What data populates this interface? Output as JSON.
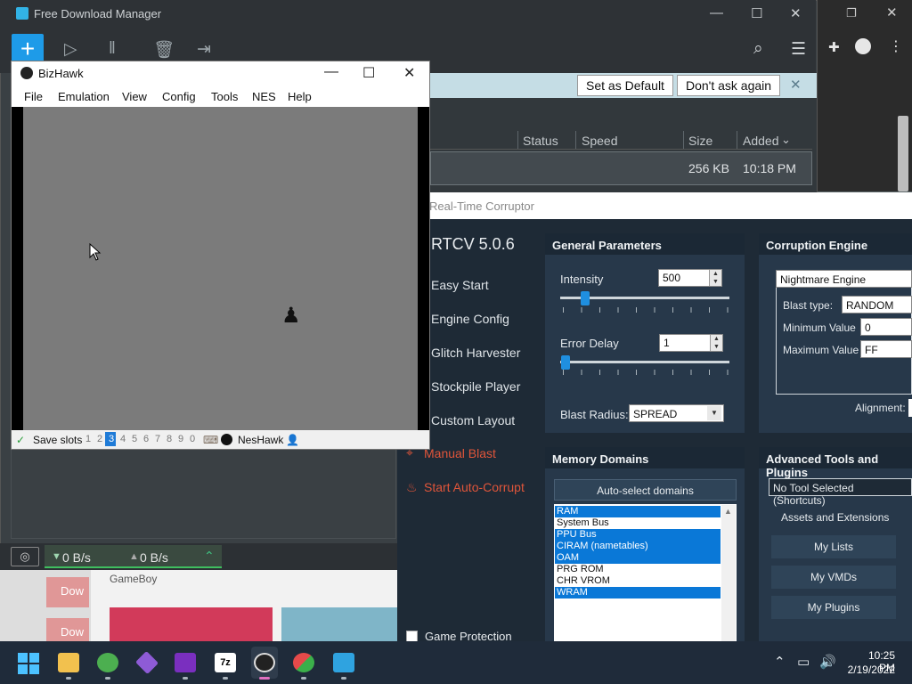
{
  "fdm": {
    "title": "Free Download Manager",
    "add_label": "+",
    "banner": {
      "set_default": "Set as Default",
      "dont_ask": "Don't ask again",
      "close": "✕"
    },
    "columns": [
      "Status",
      "Speed",
      "Size",
      "Added"
    ],
    "added_sort_arrow": "⌄",
    "row": {
      "size": "256 KB",
      "added": "10:18 PM"
    },
    "speed_down": "0 B/s",
    "speed_up": "0 B/s",
    "down_arrow": "▼",
    "up_arrow": "▲",
    "snail": "◎",
    "panel_label": "GameBoy",
    "download_btn": "Dow"
  },
  "bizhawk": {
    "title": "BizHawk",
    "menu": [
      "File",
      "Emulation",
      "View",
      "Config",
      "Tools",
      "NES",
      "Help"
    ],
    "status": {
      "save_slots": "Save slots",
      "slots": [
        "1",
        "2",
        "3",
        "4",
        "5",
        "6",
        "7",
        "8",
        "9",
        "0"
      ],
      "core": "NesHawk"
    }
  },
  "rtc": {
    "title": "Real-Time Corruptor",
    "version": "RTCV 5.0.6",
    "nav": [
      "Easy Start",
      "Engine Config",
      "Glitch Harvester",
      "Stockpile Player",
      "Custom Layout"
    ],
    "manual_blast": "Manual Blast",
    "auto_corrupt": "Start Auto-Corrupt",
    "game_protection": "Game Protection",
    "general": {
      "header": "General Parameters",
      "intensity_label": "Intensity",
      "intensity_value": "500",
      "intensity_level": 0.11,
      "error_delay_label": "Error Delay",
      "error_delay_value": "1",
      "error_delay_level": 0.0,
      "blast_radius_label": "Blast Radius:",
      "blast_radius_value": "SPREAD"
    },
    "engine": {
      "header": "Corruption Engine",
      "engine_value": "Nightmare Engine",
      "blast_type_label": "Blast type:",
      "blast_type_value": "RANDOM",
      "min_label": "Minimum Value",
      "min_value": "0",
      "max_label": "Maximum Value",
      "max_value": "FF",
      "alignment_label": "Alignment:"
    },
    "memory": {
      "header": "Memory Domains",
      "auto_select": "Auto-select domains",
      "domains": [
        {
          "name": "RAM",
          "selected": true
        },
        {
          "name": "System Bus",
          "selected": false
        },
        {
          "name": "PPU Bus",
          "selected": true
        },
        {
          "name": "CIRAM (nametables)",
          "selected": true
        },
        {
          "name": "OAM",
          "selected": true
        },
        {
          "name": "PRG ROM",
          "selected": false
        },
        {
          "name": "CHR VROM",
          "selected": false
        },
        {
          "name": "WRAM",
          "selected": true
        }
      ]
    },
    "tools": {
      "header": "Advanced Tools and Plugins",
      "select_value": "No Tool Selected (Shortcuts)",
      "assets_label": "Assets and Extensions",
      "buttons": [
        "My Lists",
        "My VMDs",
        "My Plugins"
      ]
    }
  },
  "taskbar": {
    "time": "10:25 PM",
    "date": "2/19/2022"
  },
  "colors": {
    "accent": "#1e9be8",
    "rtc_bg": "#1e2a36",
    "rtc_red": "#e0553a",
    "selection": "#0a78d7"
  }
}
